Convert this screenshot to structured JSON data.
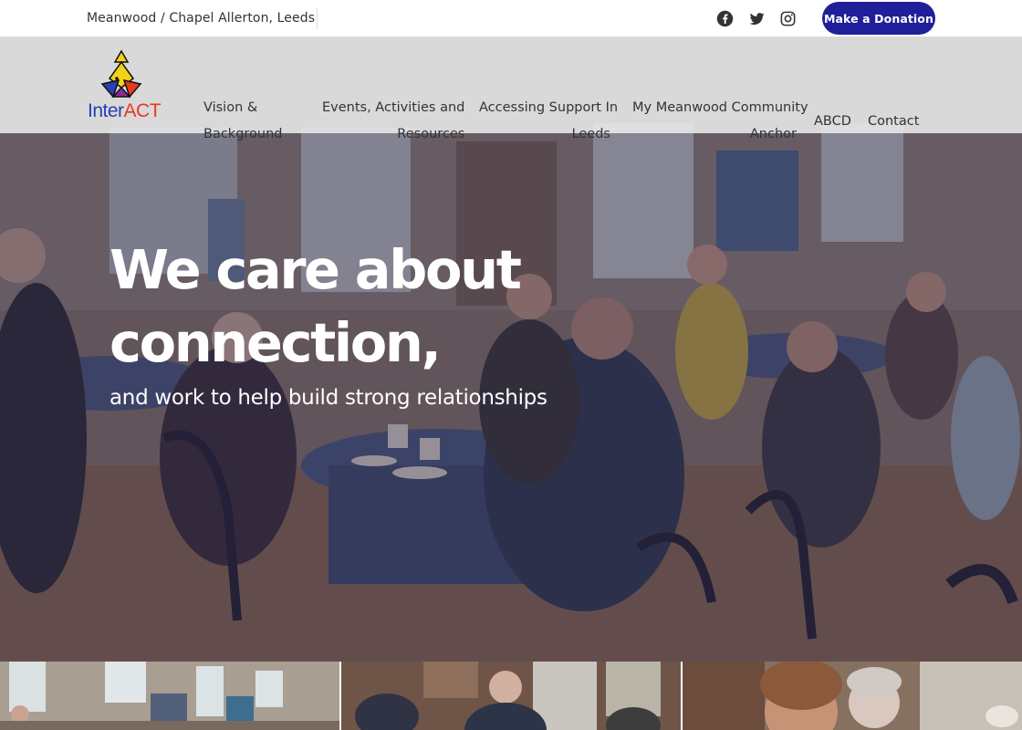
{
  "topbar": {
    "location": "Meanwood / Chapel Allerton, Leeds",
    "social": [
      {
        "icon": "facebook-icon"
      },
      {
        "icon": "twitter-icon"
      },
      {
        "icon": "instagram-icon"
      }
    ],
    "donate_label": "Make a Donation"
  },
  "logo": {
    "text_a": "Inter",
    "text_b": "ACT"
  },
  "nav": {
    "items": [
      {
        "lines": [
          "Vision &",
          "Background"
        ]
      },
      {
        "lines": [
          "Events, Activities and",
          "Resources"
        ]
      },
      {
        "lines": [
          "Accessing Support In",
          "Leeds"
        ]
      },
      {
        "lines": [
          "My Meanwood Community",
          "Anchor"
        ]
      },
      {
        "lines": [
          "ABCD"
        ]
      },
      {
        "lines": [
          "Contact"
        ]
      }
    ]
  },
  "hero": {
    "headline_line1": "We care about",
    "headline_line2": "connection,",
    "subline": "and work to help build strong relationships"
  },
  "colors": {
    "accent": "#1f1f99",
    "logo_blue": "#2541b4",
    "logo_red": "#e8381f",
    "nav_bg": "#eeeeee"
  }
}
